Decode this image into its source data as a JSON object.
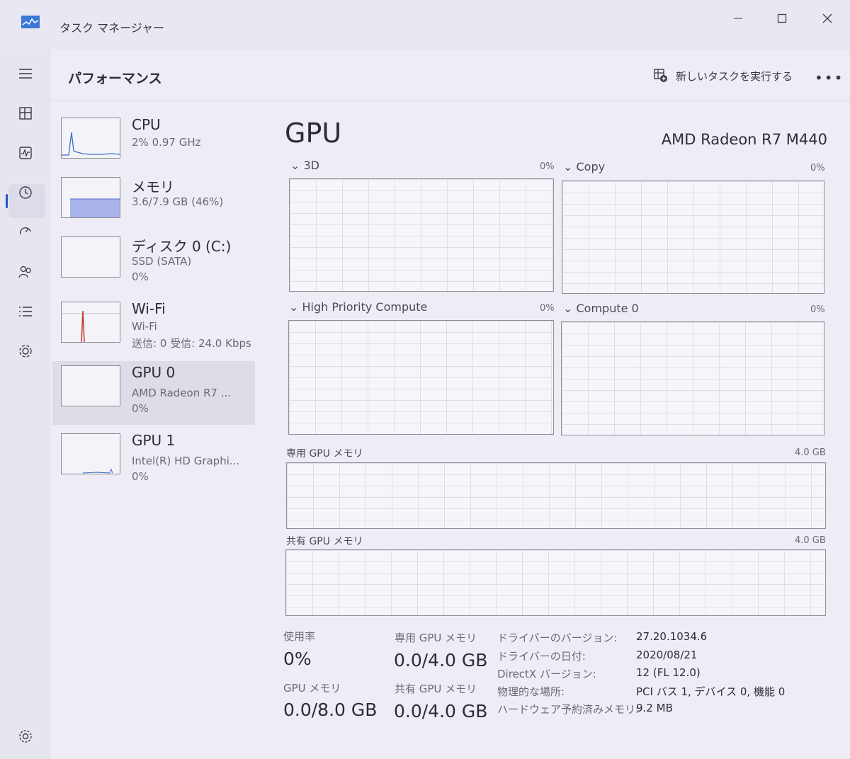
{
  "window": {
    "title": "タスク マネージャー"
  },
  "header": {
    "page_title": "パフォーマンス",
    "run_task_label": "新しいタスクを実行する",
    "more_label": "•••"
  },
  "devices": [
    {
      "name": "CPU",
      "line1": "2%  0.97 GHz",
      "line2": ""
    },
    {
      "name": "メモリ",
      "line1": "3.6/7.9 GB (46%)",
      "line2": ""
    },
    {
      "name": "ディスク 0 (C:)",
      "line1": "SSD (SATA)",
      "line2": "0%"
    },
    {
      "name": "Wi-Fi",
      "line1": "Wi-Fi",
      "line2": "送信: 0 受信: 24.0 Kbps"
    },
    {
      "name": "GPU 0",
      "line1": "AMD Radeon R7 ...",
      "line2": "0%"
    },
    {
      "name": "GPU 1",
      "line1": "Intel(R) HD Graphi...",
      "line2": "0%"
    }
  ],
  "gpu": {
    "title": "GPU",
    "model": "AMD Radeon R7 M440",
    "engines": [
      {
        "label": "3D",
        "pct": "0%"
      },
      {
        "label": "Copy",
        "pct": "0%"
      },
      {
        "label": "High Priority Compute",
        "pct": "0%"
      },
      {
        "label": "Compute 0",
        "pct": "0%"
      }
    ],
    "dedicated_mem": {
      "label": "専用 GPU メモリ",
      "max": "4.0 GB"
    },
    "shared_mem": {
      "label": "共有 GPU メモリ",
      "max": "4.0 GB"
    }
  },
  "stats": {
    "usage_label": "使用率",
    "usage_value": "0%",
    "dedicated_label": "専用 GPU メモリ",
    "dedicated_value": "0.0/4.0 GB",
    "gpumem_label": "GPU メモリ",
    "gpumem_value": "0.0/8.0 GB",
    "shared_label": "共有 GPU メモリ",
    "shared_value": "0.0/4.0 GB"
  },
  "info": [
    {
      "key": "ドライバーのバージョン:",
      "value": "27.20.1034.6"
    },
    {
      "key": "ドライバーの日付:",
      "value": "2020/08/21"
    },
    {
      "key": "DirectX バージョン:",
      "value": "12 (FL 12.0)"
    },
    {
      "key": "物理的な場所:",
      "value": "PCI バス 1, デバイス 0, 機能 0"
    },
    {
      "key": "ハードウェア予約済みメモリ:",
      "value": "9.2 MB"
    }
  ],
  "colors": {
    "accent": "#2456c7",
    "cpu_line": "#3a6fc4",
    "mem_fill": "#a9b4ec",
    "wifi_spike": "#c0392b"
  }
}
